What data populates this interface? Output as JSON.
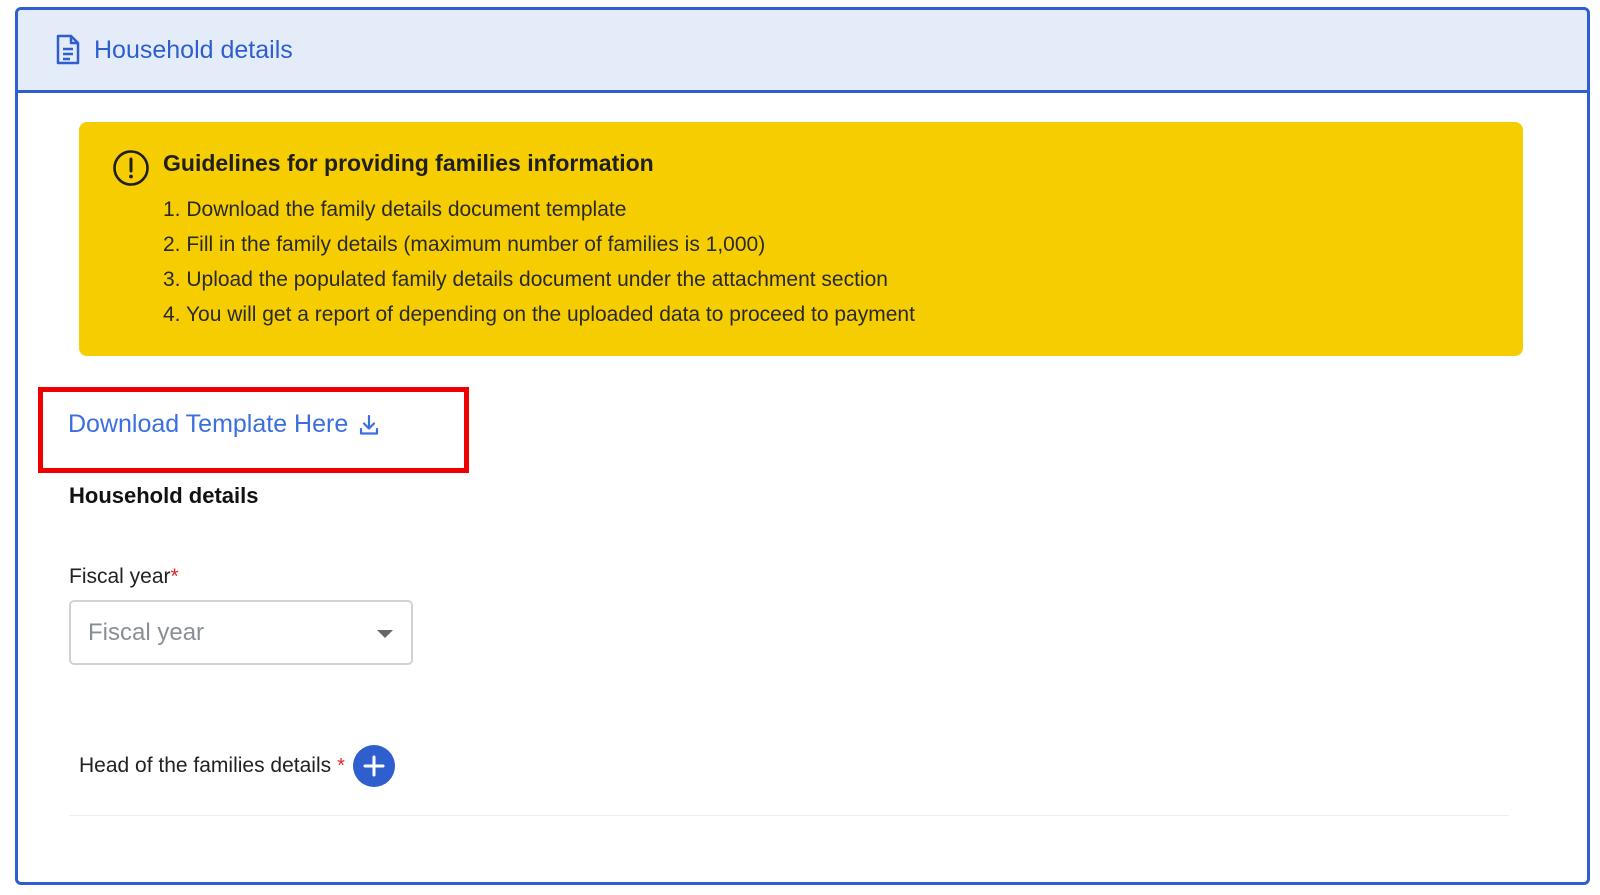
{
  "header": {
    "title": "Household details",
    "icon": "document-icon"
  },
  "guidelines": {
    "title": "Guidelines for providing families information",
    "icon": "alert-circle-icon",
    "background_color": "#f5cd00",
    "items": [
      "1. Download the family details document template",
      "2. Fill in the family details (maximum number of families is 1,000)",
      "3. Upload the populated family details document under the attachment section",
      "4. You will get a report of depending on the uploaded data to proceed to payment"
    ]
  },
  "download": {
    "label": "Download Template Here",
    "icon": "download-icon",
    "highlight_color": "#ef0000"
  },
  "section": {
    "title": "Household details"
  },
  "fiscal_year": {
    "label": "Fiscal year",
    "required_mark": "*",
    "placeholder": "Fiscal year"
  },
  "heads_of_families": {
    "label": "Head of the families details",
    "required_mark": "*",
    "add_icon": "plus-icon"
  },
  "colors": {
    "accent": "#2f5fcf",
    "link": "#3b6fe0",
    "required": "#e02424"
  }
}
